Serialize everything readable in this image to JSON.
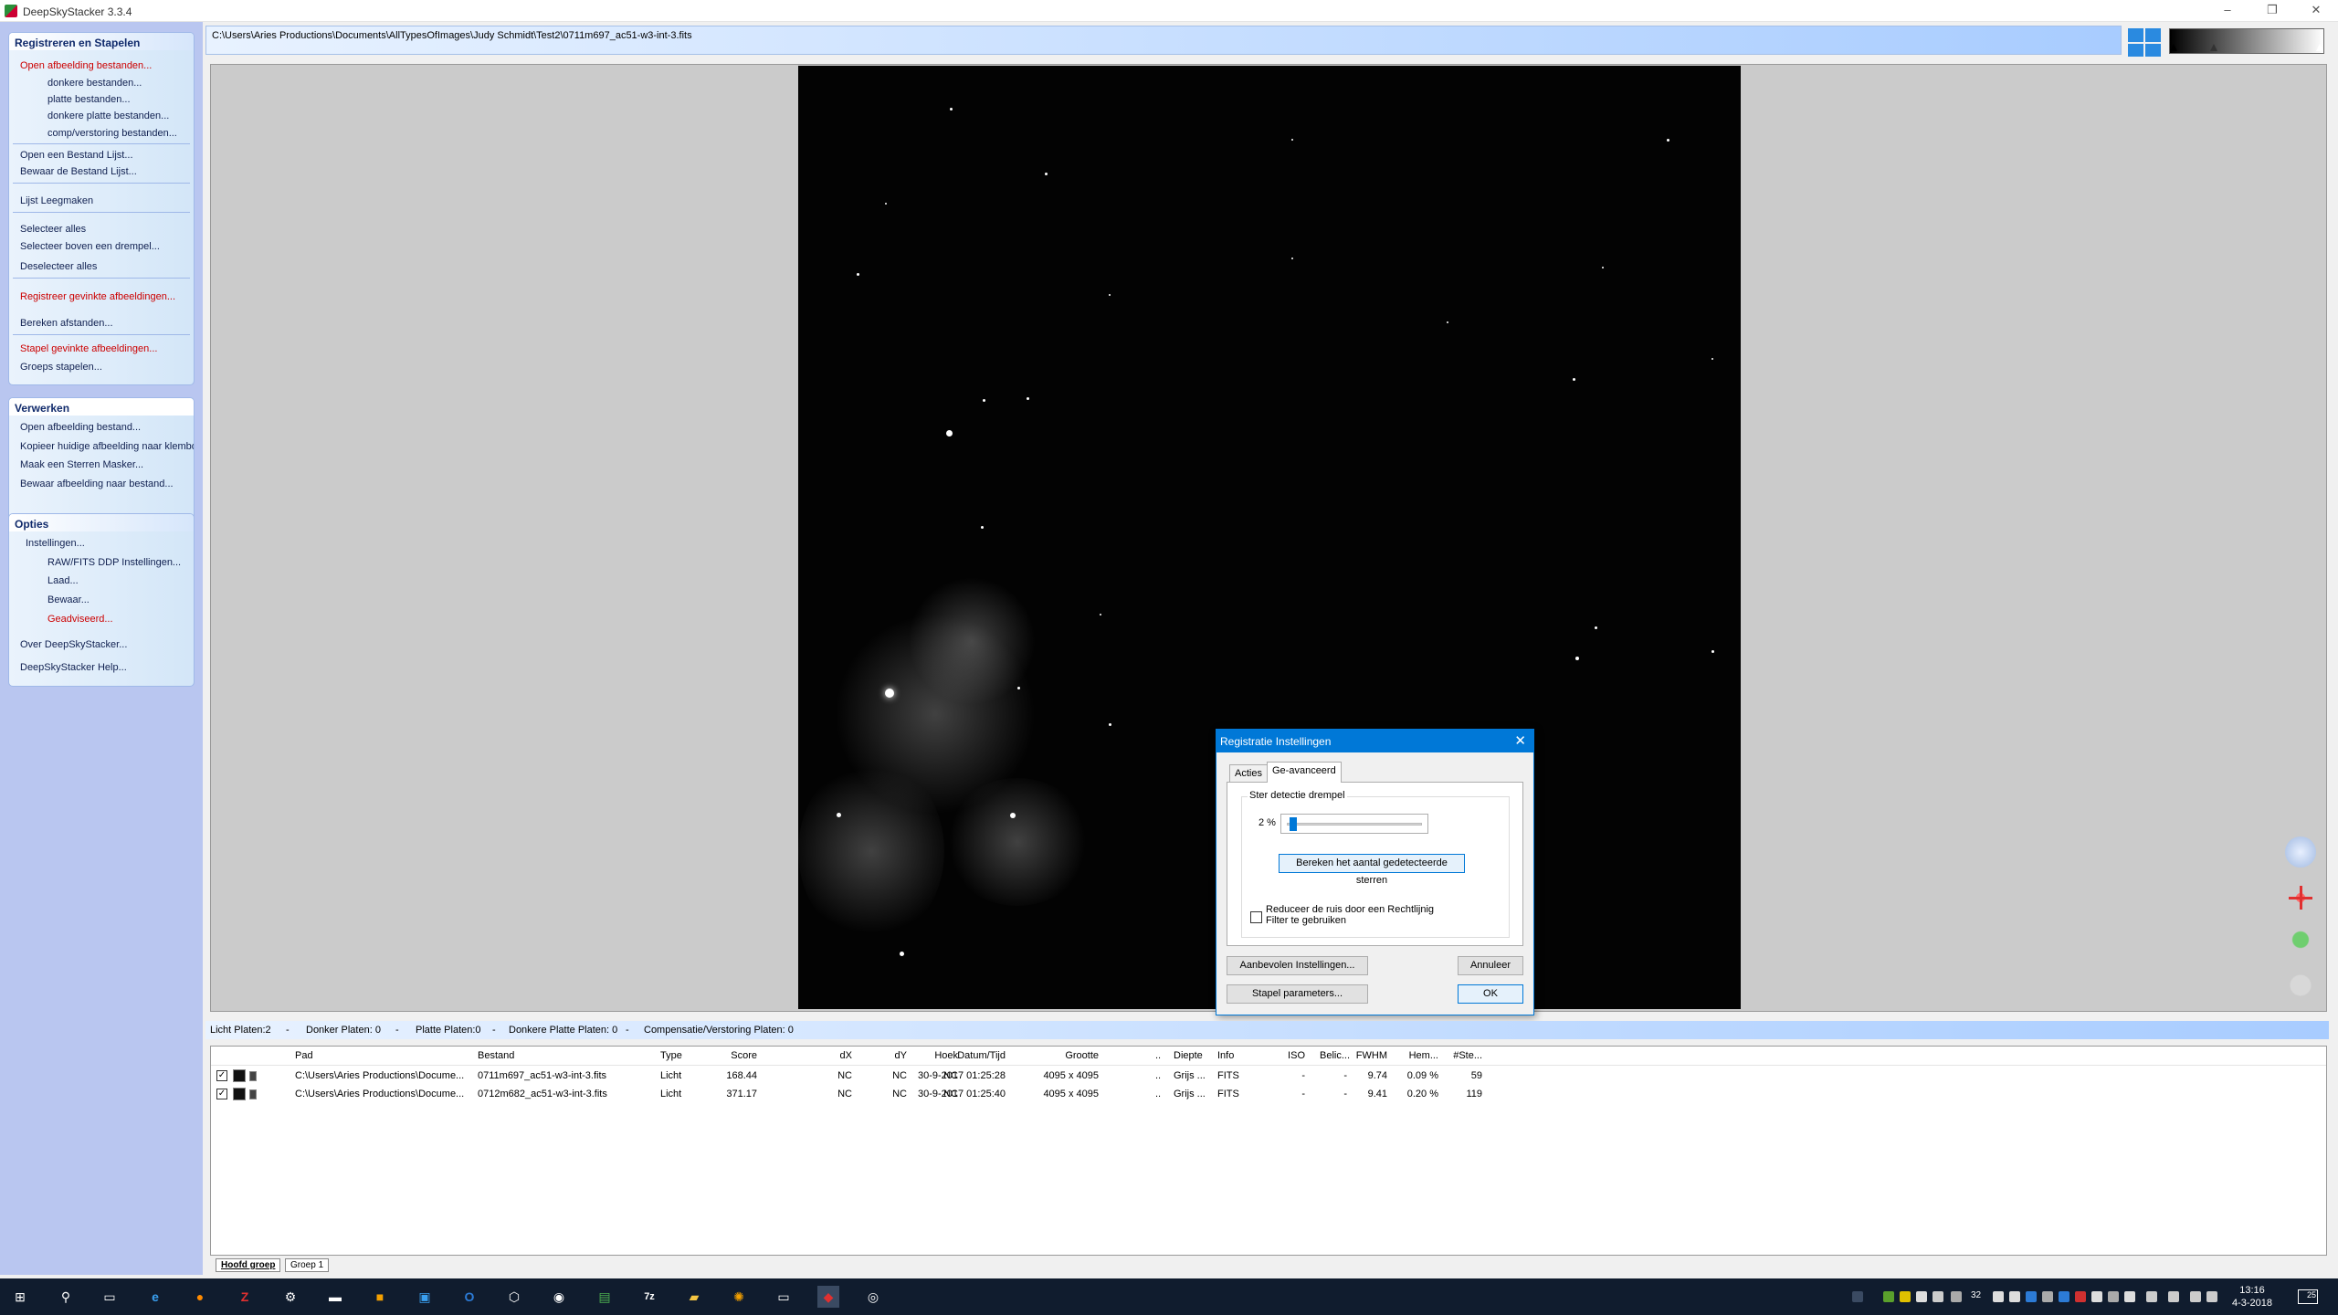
{
  "window": {
    "title": "DeepSkyStacker 3.3.4",
    "minimize": "–",
    "restore": "❐",
    "close": "✕"
  },
  "sidebar": {
    "register": {
      "header": "Registreren en Stapelen",
      "items": [
        {
          "label": "Open afbeelding bestanden...",
          "red": true
        },
        {
          "label": "donkere bestanden..."
        },
        {
          "label": "platte bestanden..."
        },
        {
          "label": "donkere platte bestanden..."
        },
        {
          "label": "comp/verstoring bestanden..."
        },
        {
          "label": "Open een Bestand Lijst..."
        },
        {
          "label": "Bewaar de Bestand Lijst..."
        },
        {
          "label": "Lijst Leegmaken"
        },
        {
          "label": "Selecteer alles"
        },
        {
          "label": "Selecteer boven een drempel..."
        },
        {
          "label": "Deselecteer alles"
        },
        {
          "label": "Registreer gevinkte afbeeldingen...",
          "red": true
        },
        {
          "label": "Bereken afstanden..."
        },
        {
          "label": "Stapel gevinkte afbeeldingen...",
          "red": true
        },
        {
          "label": "Groeps stapelen..."
        }
      ]
    },
    "process": {
      "header": "Verwerken",
      "items": [
        {
          "label": "Open afbeelding bestand..."
        },
        {
          "label": "Kopieer huidige afbeelding naar klembord"
        },
        {
          "label": "Maak een Sterren Masker..."
        },
        {
          "label": "Bewaar afbeelding naar bestand..."
        }
      ]
    },
    "options": {
      "header": "Opties",
      "items": [
        {
          "label": "Instellingen..."
        },
        {
          "label": "RAW/FITS DDP Instellingen..."
        },
        {
          "label": "Laad..."
        },
        {
          "label": "Bewaar..."
        },
        {
          "label": "Geadviseerd...",
          "red": true
        },
        {
          "label": "Over DeepSkyStacker..."
        },
        {
          "label": "DeepSkyStacker Help..."
        }
      ]
    }
  },
  "pathbar": {
    "path": "C:\\Users\\Aries Productions\\Documents\\AllTypesOfImages\\Judy Schmidt\\Test2\\0711m697_ac51-w3-int-3.fits"
  },
  "dialog": {
    "title": "Registratie Instellingen",
    "tabs": [
      "Acties",
      "Ge-avanceerd"
    ],
    "group_label": "Ster detectie drempel",
    "threshold_text": "2 %",
    "threshold_value": 2,
    "compute_button": "Bereken het aantal gedetecteerde sterren",
    "noise_checkbox": "Reduceer de ruis door een Rechtlijnig Filter te gebruiken",
    "noise_checked": false,
    "recommended_button": "Aanbevolen Instellingen...",
    "stack_params_button": "Stapel parameters...",
    "cancel_button": "Annuleer",
    "ok_button": "OK"
  },
  "status": {
    "light": "Licht Platen:2",
    "dark": "Donker Platen: 0",
    "flat": "Platte Platen:0",
    "darkflat": "Donkere Platte Platen: 0",
    "offset": "Compensatie/Verstoring Platen: 0",
    "dash": "-"
  },
  "table": {
    "columns": [
      "Pad",
      "Bestand",
      "Type",
      "Score",
      "dX",
      "dY",
      "Hoek",
      "Datum/Tijd",
      "Grootte",
      "..",
      "Diepte",
      "Info",
      "ISO",
      "Belic...",
      "FWHM",
      "Hem...",
      "#Ste..."
    ],
    "rows": [
      {
        "checked": true,
        "pad": "C:\\Users\\Aries Productions\\Docume...",
        "bestand": "0711m697_ac51-w3-int-3.fits",
        "type": "Licht",
        "score": "168.44",
        "dx": "NC",
        "dy": "NC",
        "hoek": "NC",
        "datum": "30-9-2017 01:25:28",
        "grootte": "4095 x 4095",
        "dots": "..",
        "diepte": "Grijs ...",
        "info": "FITS",
        "iso": "-",
        "belic": "-",
        "fwhm": "9.74",
        "hem": "0.09 %",
        "sterren": "59"
      },
      {
        "checked": true,
        "pad": "C:\\Users\\Aries Productions\\Docume...",
        "bestand": "0712m682_ac51-w3-int-3.fits",
        "type": "Licht",
        "score": "371.17",
        "dx": "NC",
        "dy": "NC",
        "hoek": "NC",
        "datum": "30-9-2017 01:25:40",
        "grootte": "4095 x 4095",
        "dots": "..",
        "diepte": "Grijs ...",
        "info": "FITS",
        "iso": "-",
        "belic": "-",
        "fwhm": "9.41",
        "hem": "0.20 %",
        "sterren": "119"
      }
    ]
  },
  "group_tabs": [
    "Hoofd groep",
    "Groep 1"
  ],
  "taskbar": {
    "time": "13:16",
    "date": "4-3-2018",
    "notification_count": "25",
    "tray_number": "32"
  },
  "colors": {
    "accent": "#0078d7",
    "sidebar_bg": "#b9c6f0",
    "red_item": "#cc0000",
    "taskbar": "#101c2e"
  }
}
